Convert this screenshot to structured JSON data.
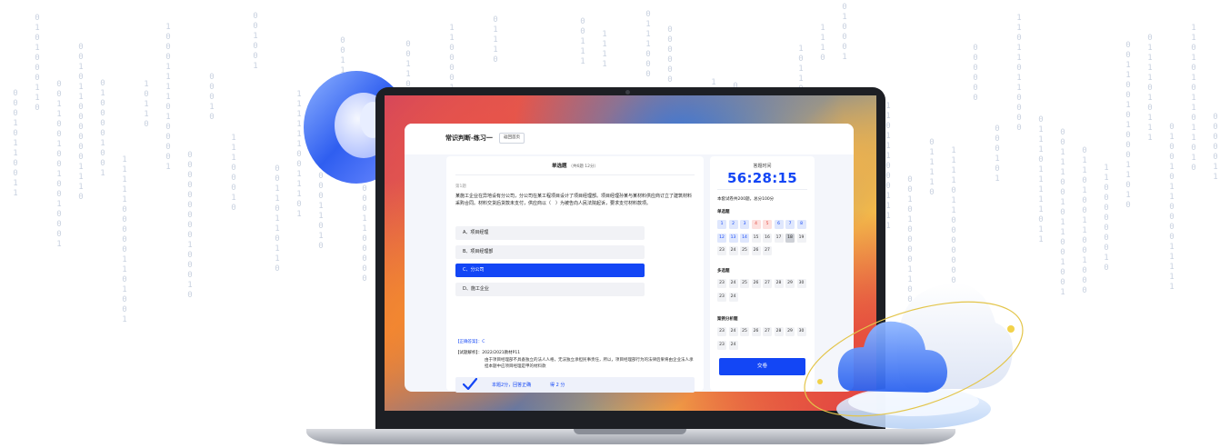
{
  "app": {
    "title": "常识判断-练习一",
    "back_button": "返回首页"
  },
  "question_panel": {
    "section_title": "单选题",
    "section_subtitle": "（共6题 12分）",
    "question_number": "第1题",
    "question_text": "某施工企业在异地设有分公司，分公司在某工程项目设计了项目经理部。项目经理孙某与某材料供应商订立了建筑材料采购合同。材料交货后货款未支付，供应商以（　）为被告向人民法院起诉，要求支付材料款项。",
    "options": [
      {
        "label": "A、项目经理",
        "selected": false
      },
      {
        "label": "B、项目经理部",
        "selected": false
      },
      {
        "label": "C、分公司",
        "selected": true
      },
      {
        "label": "D、施工企业",
        "selected": false
      }
    ],
    "correct_answer": "【正确答案】：C",
    "analysis_label": "【试题解析】：2022/2021教材P11",
    "analysis_text": "由于项目经理部不具备独立的法人人格，无法独立承担民事责任，所以，项目经理部行为的法律后果将由企业法人承担本题中应项目经理是甲的材料款",
    "result_text": "本题2分，回答正确",
    "result_score": "得 2 分"
  },
  "side_panel": {
    "timer_label": "答题时间",
    "timer_value": "56:28:15",
    "exam_info": "本套试卷共200题，总分100分",
    "sections": [
      {
        "title": "单选题",
        "rows": [
          [
            {
              "n": "1",
              "state": "correct"
            },
            {
              "n": "2",
              "state": "correct"
            },
            {
              "n": "3",
              "state": "correct"
            },
            {
              "n": "4",
              "state": "wrong"
            },
            {
              "n": "5",
              "state": "wrong"
            },
            {
              "n": "6",
              "state": "correct"
            },
            {
              "n": "7",
              "state": "correct"
            },
            {
              "n": "8",
              "state": "correct"
            }
          ],
          [
            {
              "n": "12",
              "state": "correct"
            },
            {
              "n": "13",
              "state": "correct"
            },
            {
              "n": "14",
              "state": "correct"
            },
            {
              "n": "15",
              "state": "normal"
            },
            {
              "n": "16",
              "state": "normal"
            },
            {
              "n": "17",
              "state": "normal"
            },
            {
              "n": "18",
              "state": "current"
            },
            {
              "n": "19",
              "state": "normal"
            }
          ],
          [
            {
              "n": "23",
              "state": "normal"
            },
            {
              "n": "24",
              "state": "normal"
            },
            {
              "n": "25",
              "state": "normal"
            },
            {
              "n": "26",
              "state": "normal"
            },
            {
              "n": "27",
              "state": "normal"
            }
          ]
        ]
      },
      {
        "title": "多选题",
        "rows": [
          [
            {
              "n": "23",
              "state": "normal"
            },
            {
              "n": "24",
              "state": "normal"
            },
            {
              "n": "25",
              "state": "normal"
            },
            {
              "n": "26",
              "state": "normal"
            },
            {
              "n": "27",
              "state": "normal"
            },
            {
              "n": "28",
              "state": "normal"
            },
            {
              "n": "29",
              "state": "normal"
            },
            {
              "n": "30",
              "state": "normal"
            }
          ],
          [
            {
              "n": "23",
              "state": "normal"
            },
            {
              "n": "24",
              "state": "normal"
            }
          ]
        ]
      },
      {
        "title": "案例分析题",
        "rows": [
          [
            {
              "n": "23",
              "state": "normal"
            },
            {
              "n": "24",
              "state": "normal"
            },
            {
              "n": "25",
              "state": "normal"
            },
            {
              "n": "26",
              "state": "normal"
            },
            {
              "n": "27",
              "state": "normal"
            },
            {
              "n": "28",
              "state": "normal"
            },
            {
              "n": "29",
              "state": "normal"
            },
            {
              "n": "30",
              "state": "normal"
            }
          ],
          [
            {
              "n": "23",
              "state": "normal"
            },
            {
              "n": "24",
              "state": "normal"
            }
          ]
        ]
      }
    ],
    "submit_button": "交卷"
  },
  "colors": {
    "accent": "#1346f5",
    "correct_bg": "#dfe7fd",
    "wrong_bg": "#fde0de",
    "wrong_text": "#e0463b"
  }
}
